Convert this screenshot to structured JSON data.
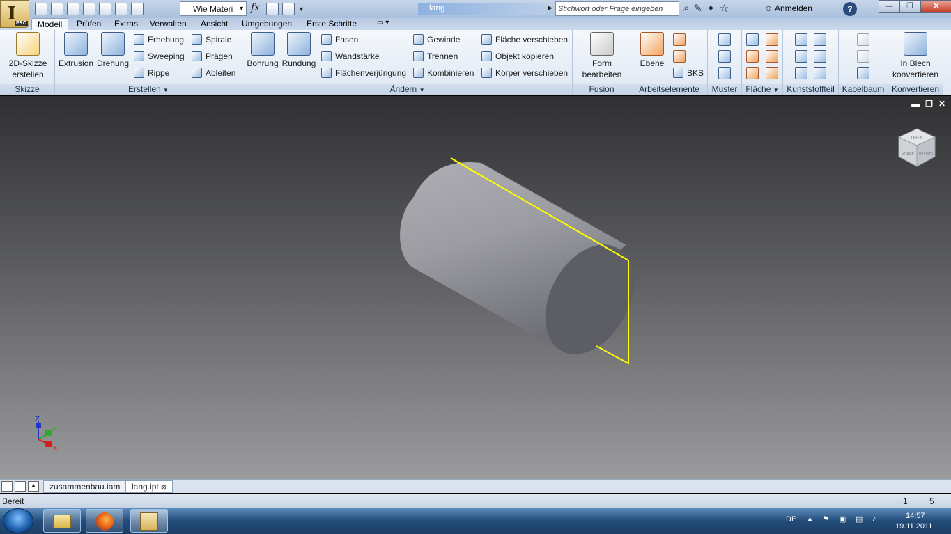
{
  "title_bar": {
    "material": "Wie Materi",
    "fx_symbol": "fx",
    "document_title": "lang",
    "search_placeholder": "Stichwort oder Frage eingeben",
    "sign_in": "Anmelden",
    "help_symbol": "?"
  },
  "app_button": {
    "logo": "I",
    "edition": "PRO"
  },
  "tabs": [
    "Modell",
    "Prüfen",
    "Extras",
    "Verwalten",
    "Ansicht",
    "Umgebungen",
    "Erste Schritte"
  ],
  "ribbon": {
    "skizze": {
      "label": "Skizze",
      "sketch_button": "2D-Skizze erstellen"
    },
    "erstellen": {
      "label": "Erstellen",
      "extrusion": "Extrusion",
      "drehung": "Drehung",
      "erhebung": "Erhebung",
      "sweeping": "Sweeping",
      "rippe": "Rippe",
      "spirale": "Spirale",
      "praegen": "Prägen",
      "ableiten": "Ableiten"
    },
    "aendern": {
      "label": "Ändern",
      "bohrung": "Bohrung",
      "rundung": "Rundung",
      "fasen": "Fasen",
      "wandstaerke": "Wandstärke",
      "flaechenverjuengung": "Flächenverjüngung",
      "gewinde": "Gewinde",
      "trennen": "Trennen",
      "kombinieren": "Kombinieren",
      "flaeche_verschieben": "Fläche verschieben",
      "objekt_kopieren": "Objekt kopieren",
      "koerper_verschieben": "Körper verschieben"
    },
    "fusion": {
      "label": "Fusion",
      "form_bearbeiten": "Form bearbeiten"
    },
    "arbeitselemente": {
      "label": "Arbeitselemente",
      "ebene": "Ebene",
      "bks": "BKS"
    },
    "muster": {
      "label": "Muster"
    },
    "flaeche": {
      "label": "Fläche"
    },
    "kunststoffteil": {
      "label": "Kunststoffteil"
    },
    "kabelbaum": {
      "label": "Kabelbaum"
    },
    "konvertieren": {
      "label": "Konvertieren",
      "in_blech": "In Blech konvertieren"
    }
  },
  "viewport": {
    "viewcube_faces": {
      "top": "OBEN",
      "front": "VORNE",
      "right": "RECHTS"
    },
    "axes": {
      "x": "X",
      "y": "Y",
      "z": "Z"
    },
    "colors": {
      "sketch_plane": "#ffff00",
      "axis_x": "#d62020",
      "axis_y": "#2fa82f",
      "axis_z": "#2335c9"
    }
  },
  "doc_tabs": [
    "zusammenbau.iam",
    "lang.ipt"
  ],
  "status": {
    "text": "Bereit",
    "value_1": "1",
    "value_2": "5"
  },
  "taskbar": {
    "lang": "DE",
    "time": "14:57",
    "date": "19.11.2011"
  }
}
